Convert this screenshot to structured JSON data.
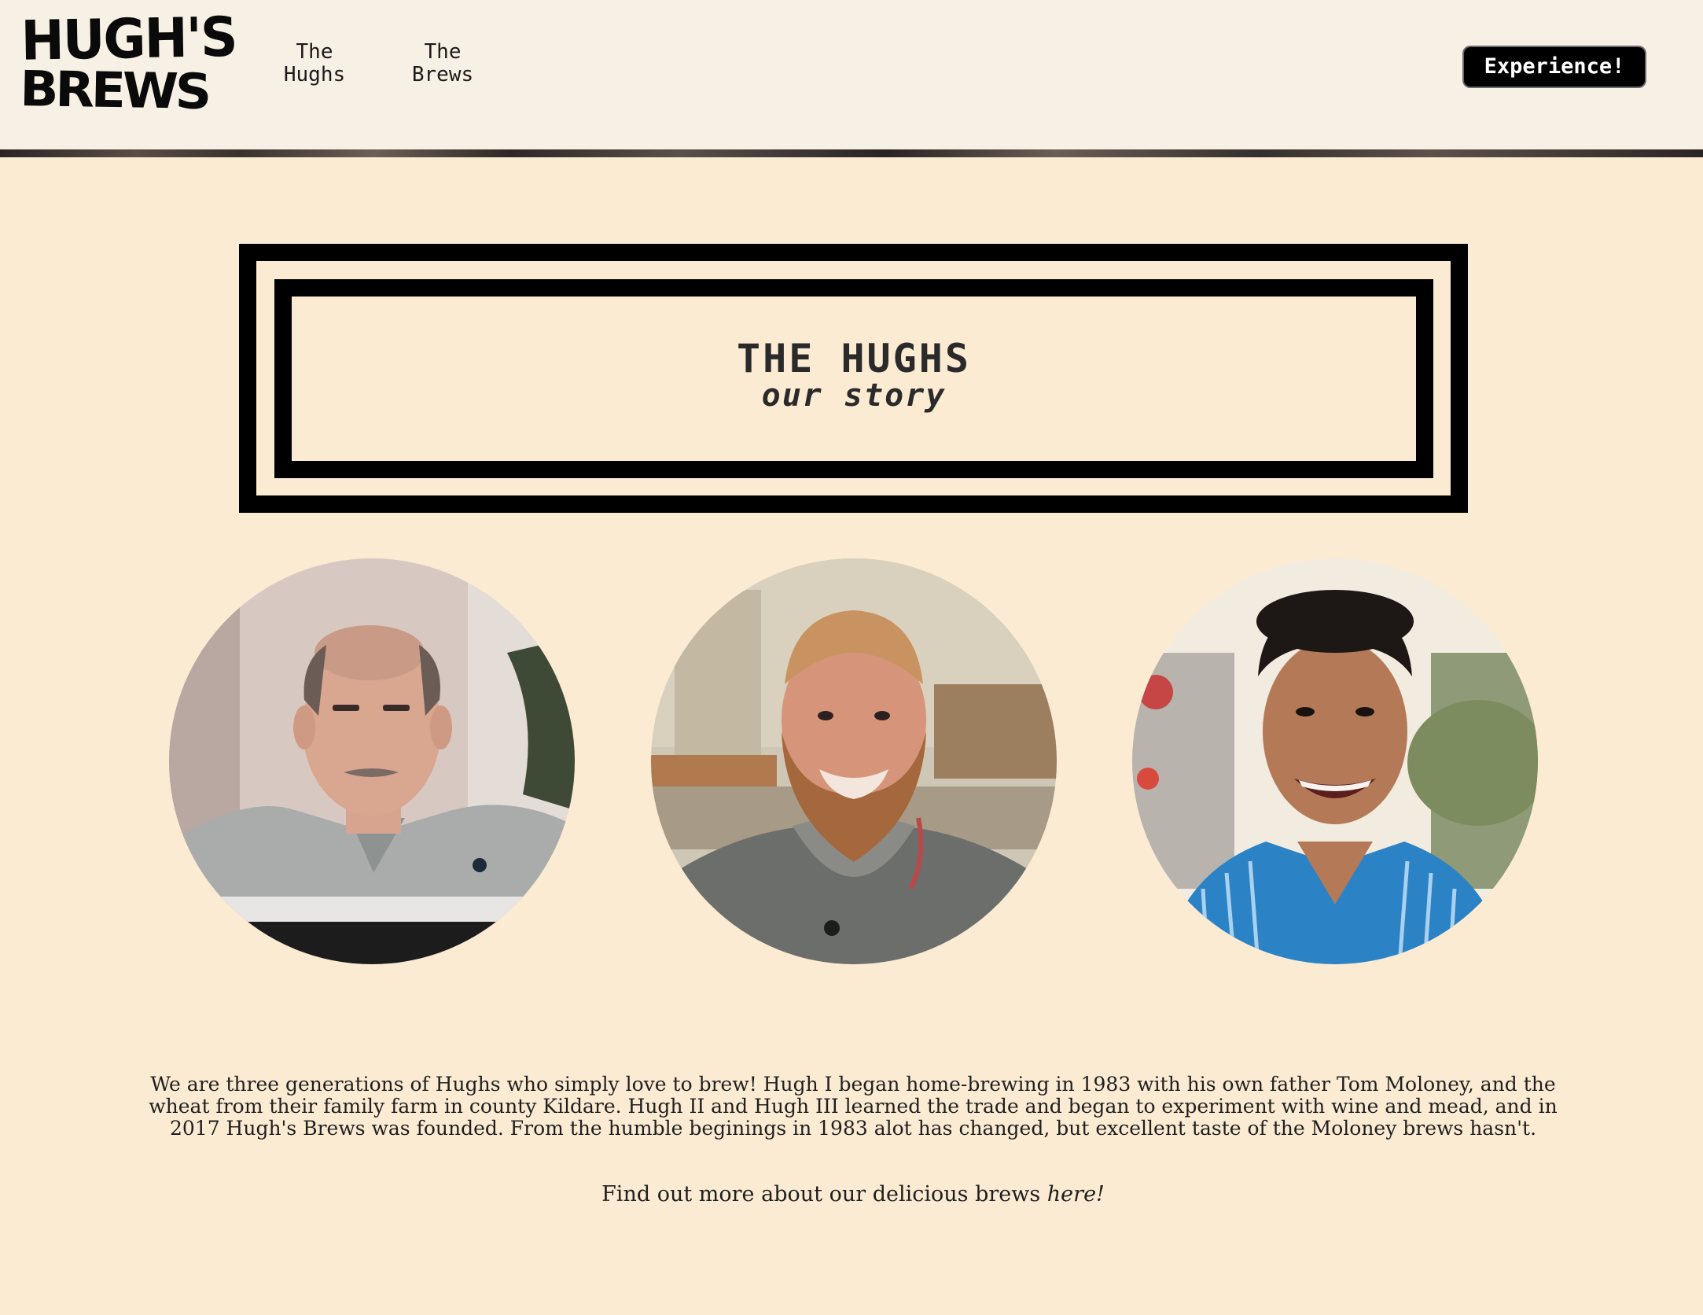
{
  "header": {
    "logo": {
      "line1": "HUGH'S",
      "line2": "BREWS"
    },
    "nav": [
      {
        "label": "The\nHughs"
      },
      {
        "label": "The\nBrews"
      }
    ],
    "cta_label": "Experience!"
  },
  "hero": {
    "title": "THE HUGHS",
    "subtitle": "our story"
  },
  "portraits": [
    {
      "alt_icon": "portrait-hugh-i"
    },
    {
      "alt_icon": "portrait-hugh-ii"
    },
    {
      "alt_icon": "portrait-hugh-iii"
    }
  ],
  "story": {
    "paragraph": "We are three generations of Hughs who simply love to brew! Hugh I began home-brewing in 1983 with his own father Tom Moloney, and the wheat from their family farm in county Kildare. Hugh II and Hugh III learned the trade and began to experiment with wine and mead, and in 2017 Hugh's Brews was founded. From the humble beginings in 1983 alot has changed, but excellent taste of the Moloney brews hasn't.",
    "more_prefix": "Find out more about our delicious brews ",
    "more_link": "here!"
  },
  "colors": {
    "page_bg": "#fcebd3",
    "header_bg": "#f7f0e4",
    "ink": "#000000",
    "cta_bg": "#000000",
    "cta_text": "#ffffff"
  }
}
